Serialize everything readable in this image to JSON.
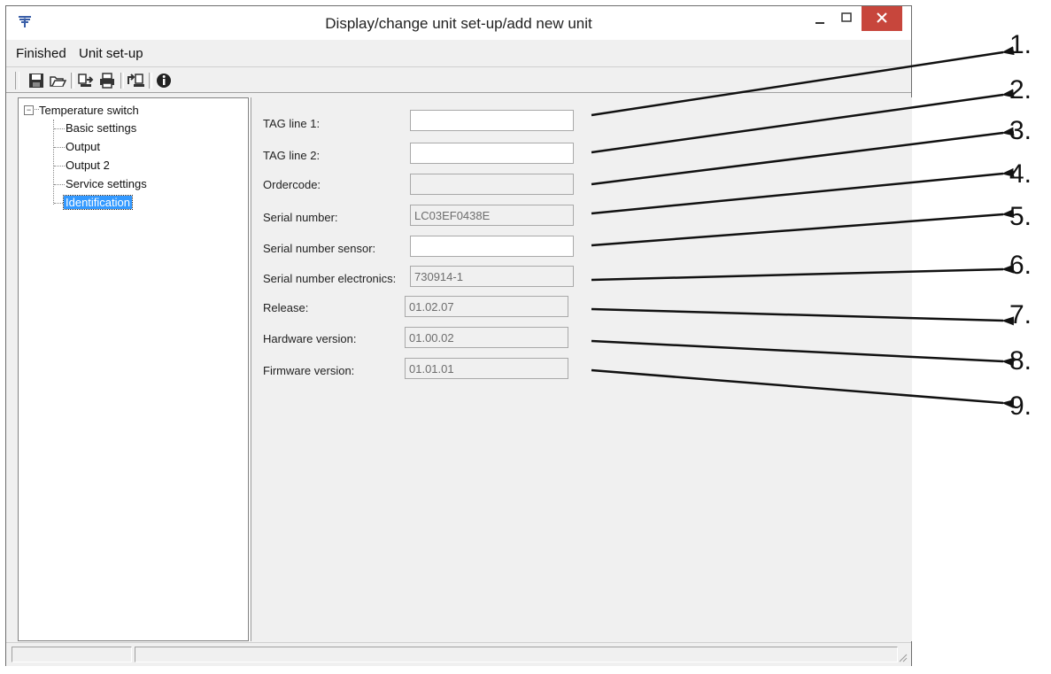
{
  "window": {
    "title": "Display/change unit set-up/add new unit"
  },
  "menu": {
    "items": [
      "Finished",
      "Unit set-up"
    ]
  },
  "toolbar": {
    "buttons": [
      "save-icon",
      "open-folder-icon",
      "read-unit-icon",
      "print-icon",
      "write-unit-icon",
      "info-icon"
    ]
  },
  "tree": {
    "root": "Temperature switch",
    "expander": "−",
    "children": [
      "Basic settings",
      "Output",
      "Output 2",
      "Service settings",
      "Identification"
    ],
    "selected": "Identification"
  },
  "form": {
    "fields": [
      {
        "label": "TAG line 1:",
        "value": "",
        "editable": true
      },
      {
        "label": "TAG line 2:",
        "value": "",
        "editable": true
      },
      {
        "label": "Ordercode:",
        "value": "",
        "editable": false
      },
      {
        "label": "Serial number:",
        "value": "LC03EF0438E",
        "editable": false
      },
      {
        "label": "Serial number sensor:",
        "value": "",
        "editable": true
      },
      {
        "label": "Serial number electronics:",
        "value": "730914-1",
        "editable": false
      },
      {
        "label": "Release:",
        "value": "01.02.07",
        "editable": false
      },
      {
        "label": "Hardware version:",
        "value": "01.00.02",
        "editable": false
      },
      {
        "label": "Firmware version:",
        "value": "01.01.01",
        "editable": false
      }
    ]
  },
  "callouts": [
    "1.",
    "2.",
    "3.",
    "4.",
    "5.",
    "6.",
    "7.",
    "8.",
    "9."
  ],
  "colors": {
    "selection": "#3399ff",
    "close_button": "#c7463c"
  }
}
